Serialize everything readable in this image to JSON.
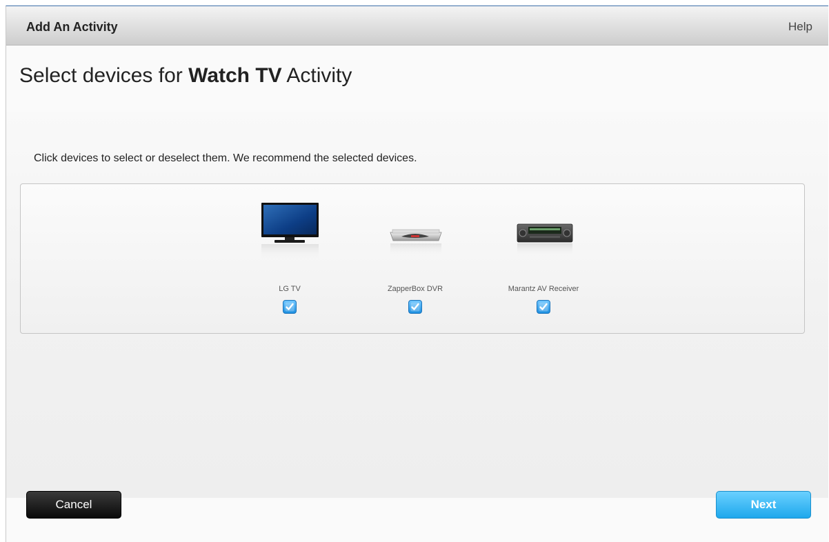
{
  "window": {
    "title": "Add An Activity",
    "help_label": "Help"
  },
  "heading": {
    "prefix": "Select devices for ",
    "activity": "Watch TV",
    "suffix": " Activity"
  },
  "instruction": "Click devices to select or deselect them. We recommend the selected devices.",
  "devices": [
    {
      "label": "LG TV",
      "icon": "tv-icon",
      "selected": true
    },
    {
      "label": "ZapperBox DVR",
      "icon": "dvr-icon",
      "selected": true
    },
    {
      "label": "Marantz AV Receiver",
      "icon": "av-receiver-icon",
      "selected": true
    }
  ],
  "buttons": {
    "cancel": "Cancel",
    "next": "Next"
  },
  "colors": {
    "accent": "#1ea8ec",
    "checkbox": "#2a9be6",
    "cancel_bg": "#111111"
  }
}
